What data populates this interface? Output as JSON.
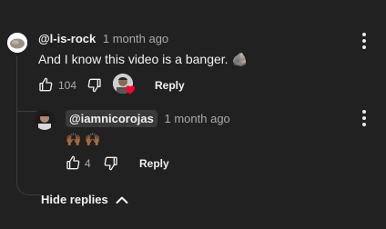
{
  "comment": {
    "author": "@l-is-rock",
    "time": "1 month ago",
    "text": "And I know this video is a banger. 🪨",
    "likes": "104",
    "reply_label": "Reply"
  },
  "reply": {
    "author": "@iamnicorojas",
    "time": "1 month ago",
    "text": "🙌🏾 🙌🏾",
    "likes": "4",
    "reply_label": "Reply"
  },
  "hide_replies_label": "Hide replies",
  "icons": [
    "rock-avatar",
    "thumbs-up-icon",
    "thumbs-down-icon",
    "creator-heart-icon",
    "more-vert-icon",
    "chevron-up-icon"
  ],
  "colors": {
    "background": "#212121",
    "heart": "#ff0033",
    "muted": "#aaaaaa"
  }
}
